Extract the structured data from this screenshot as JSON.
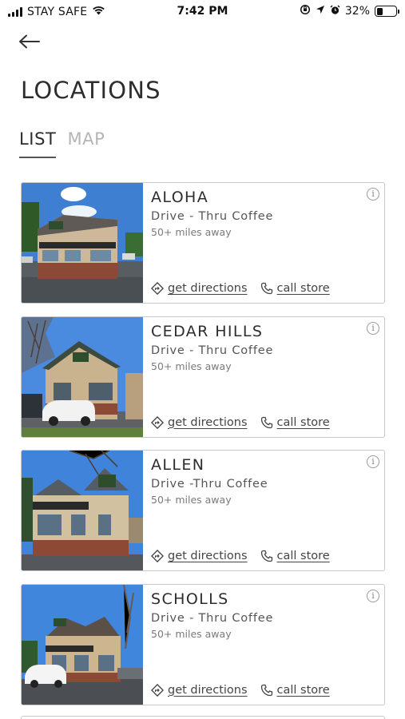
{
  "status_bar": {
    "carrier": "STAY SAFE",
    "time": "7:42 PM",
    "battery_text": "32%",
    "battery_level": 0.32
  },
  "header": {
    "back_icon": "arrow-left-icon",
    "title": "LOCATIONS"
  },
  "tabs": [
    {
      "label": "LIST",
      "active": true
    },
    {
      "label": "MAP",
      "active": false
    }
  ],
  "locations": [
    {
      "name": "ALOHA",
      "type": "Drive - Thru Coffee",
      "distance": "50+ miles away",
      "directions_label": "get directions",
      "call_label": "call store"
    },
    {
      "name": "CEDAR HILLS",
      "type": "Drive - Thru Coffee",
      "distance": "50+ miles away",
      "directions_label": "get directions",
      "call_label": "call store"
    },
    {
      "name": "ALLEN",
      "type": "Drive -Thru Coffee",
      "distance": "50+ miles away",
      "directions_label": "get directions",
      "call_label": "call store"
    },
    {
      "name": "SCHOLLS",
      "type": "Drive - Thru Coffee",
      "distance": "50+ miles away",
      "directions_label": "get directions",
      "call_label": "call store"
    }
  ],
  "colors": {
    "text_primary": "#2d2d2d",
    "tab_inactive": "#b5b5b5",
    "card_border": "#c9c9c9",
    "sky": "#3f7fd1",
    "building_beige": "#c9b38f",
    "brick": "#8c4a36"
  }
}
